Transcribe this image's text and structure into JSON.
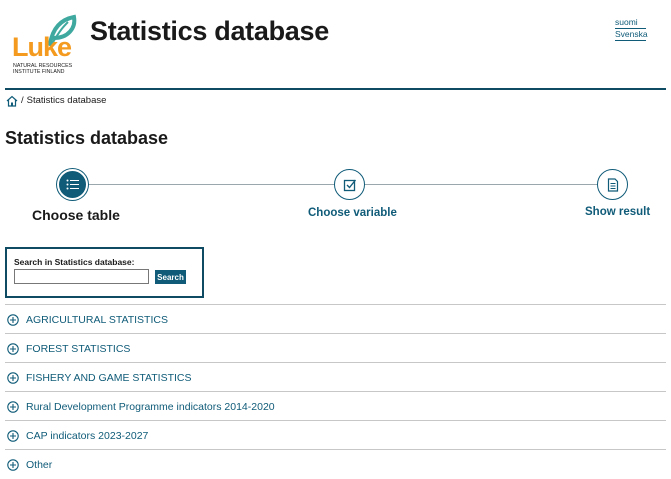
{
  "header": {
    "logo_word": "Luke",
    "logo_subtitle_line1": "NATURAL RESOURCES",
    "logo_subtitle_line2": "INSTITUTE FINLAND",
    "site_title": "Statistics database",
    "languages": [
      "suomi",
      "Svenska"
    ]
  },
  "breadcrumb": {
    "separator": "/",
    "current": "Statistics database"
  },
  "page_title": "Statistics database",
  "steps": [
    {
      "label": "Choose table",
      "state": "active",
      "icon": "list-icon"
    },
    {
      "label": "Choose variable",
      "state": "link",
      "icon": "checkbox-icon"
    },
    {
      "label": "Show result",
      "state": "link",
      "icon": "document-icon"
    }
  ],
  "search": {
    "label": "Search in Statistics database:",
    "value": "",
    "button_label": "Search"
  },
  "categories": [
    "AGRICULTURAL STATISTICS",
    "FOREST STATISTICS",
    "FISHERY AND GAME STATISTICS",
    "Rural Development Programme indicators 2014-2020",
    "CAP indicators 2023-2027",
    "Other"
  ],
  "colors": {
    "accent": "#0f5b78",
    "brand_orange": "#f39a1f",
    "brand_green": "#3fa9a0",
    "rule": "#0f4c63"
  }
}
